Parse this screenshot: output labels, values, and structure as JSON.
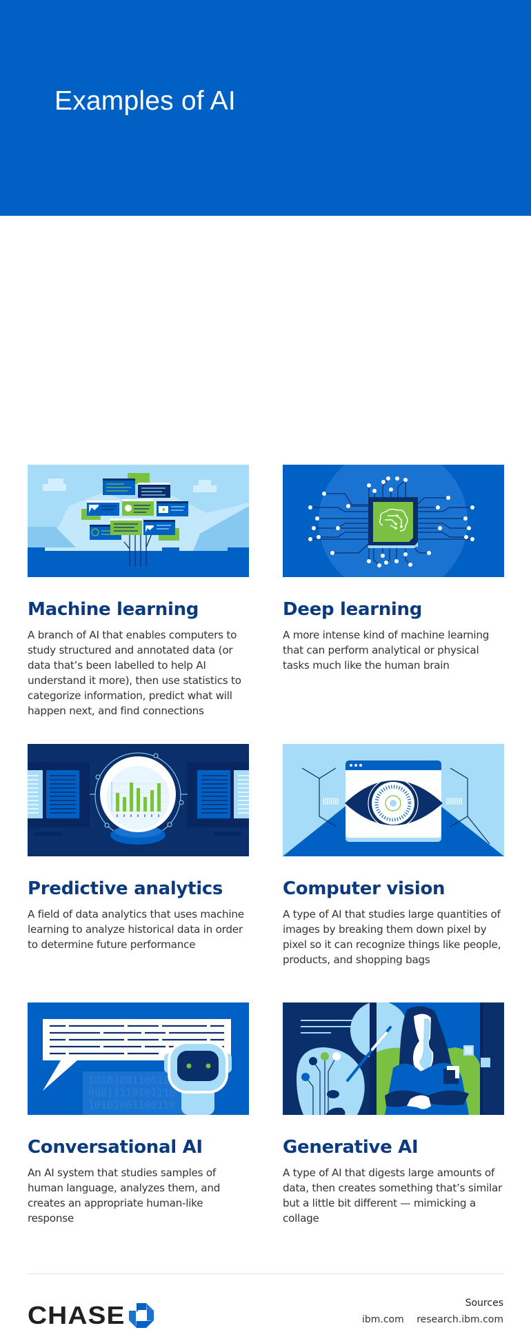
{
  "hero": {
    "title": "Examples of AI",
    "background": "#0060c4"
  },
  "cards": [
    {
      "title": "Machine learning",
      "description": "A branch of AI that enables computers to study structured and annotated data (or data that’s been labelled to help AI understand it more), then use statistics to categorize information, predict what will happen next, and find connections",
      "illustration": "tree-of-data-cards-icon"
    },
    {
      "title": "Deep learning",
      "description": "A more intense kind of machine learning that can perform analytical or physical tasks much like the human brain",
      "illustration": "brain-chip-icon"
    },
    {
      "title": "Predictive analytics",
      "description": "A field of data analytics that uses machine learning to analyze historical data in order to determine future performance",
      "illustration": "crystal-ball-chart-icon"
    },
    {
      "title": "Computer vision",
      "description": "A type of AI that studies large quantities of images by breaking them down pixel by pixel so it can recognize things like people, products, and shopping bags",
      "illustration": "eye-in-browser-icon"
    },
    {
      "title": "Conversational AI",
      "description": "An AI system that studies samples of human language, analyzes them, and creates an appropriate human-like response",
      "illustration": "robot-speech-bubble-icon",
      "binary_lines": [
        "10101001100110",
        "00011110101110",
        "10101001100110"
      ]
    },
    {
      "title": "Generative AI",
      "description": "A type of AI that digests large amounts of data, then creates something that’s similar but a little bit different — mimicking a collage",
      "illustration": "palette-portrait-icon"
    }
  ],
  "footer": {
    "brand": "CHASE",
    "sources_title": "Sources",
    "sources": [
      "ibm.com",
      "research.ibm.com"
    ]
  },
  "colors": {
    "brand_blue": "#0060c4",
    "navy": "#0b3a7e",
    "dark_navy": "#0a2f6b",
    "light_blue": "#a6dcf8",
    "green": "#7ac143",
    "text": "#333333"
  }
}
